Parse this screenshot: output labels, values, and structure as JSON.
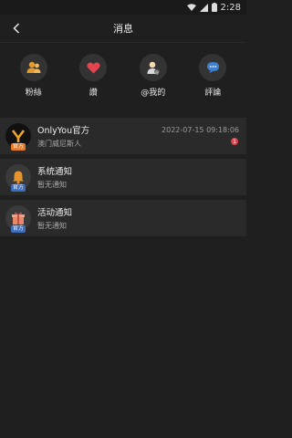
{
  "status_bar": {
    "time": "2:28"
  },
  "header": {
    "title": "消息"
  },
  "quick_actions": [
    {
      "label": "粉絲",
      "icon": "fans-icon",
      "color": "#e39a2e"
    },
    {
      "label": "讚",
      "icon": "heart-icon",
      "color": "#e5444f"
    },
    {
      "label": "@我的",
      "icon": "mention-user-icon",
      "color": "#d8d8d8"
    },
    {
      "label": "評論",
      "icon": "comment-icon",
      "color": "#3f7fd0"
    }
  ],
  "messages": [
    {
      "title": "OnlyYou官方",
      "subtitle": "澳门威尼斯人",
      "time": "2022-07-15 09:18:06",
      "badge": "官方",
      "unread": "1"
    },
    {
      "title": "系统通知",
      "subtitle": "暂无通知",
      "badge": "官方"
    },
    {
      "title": "活动通知",
      "subtitle": "暂无通知",
      "badge": "官方"
    }
  ]
}
